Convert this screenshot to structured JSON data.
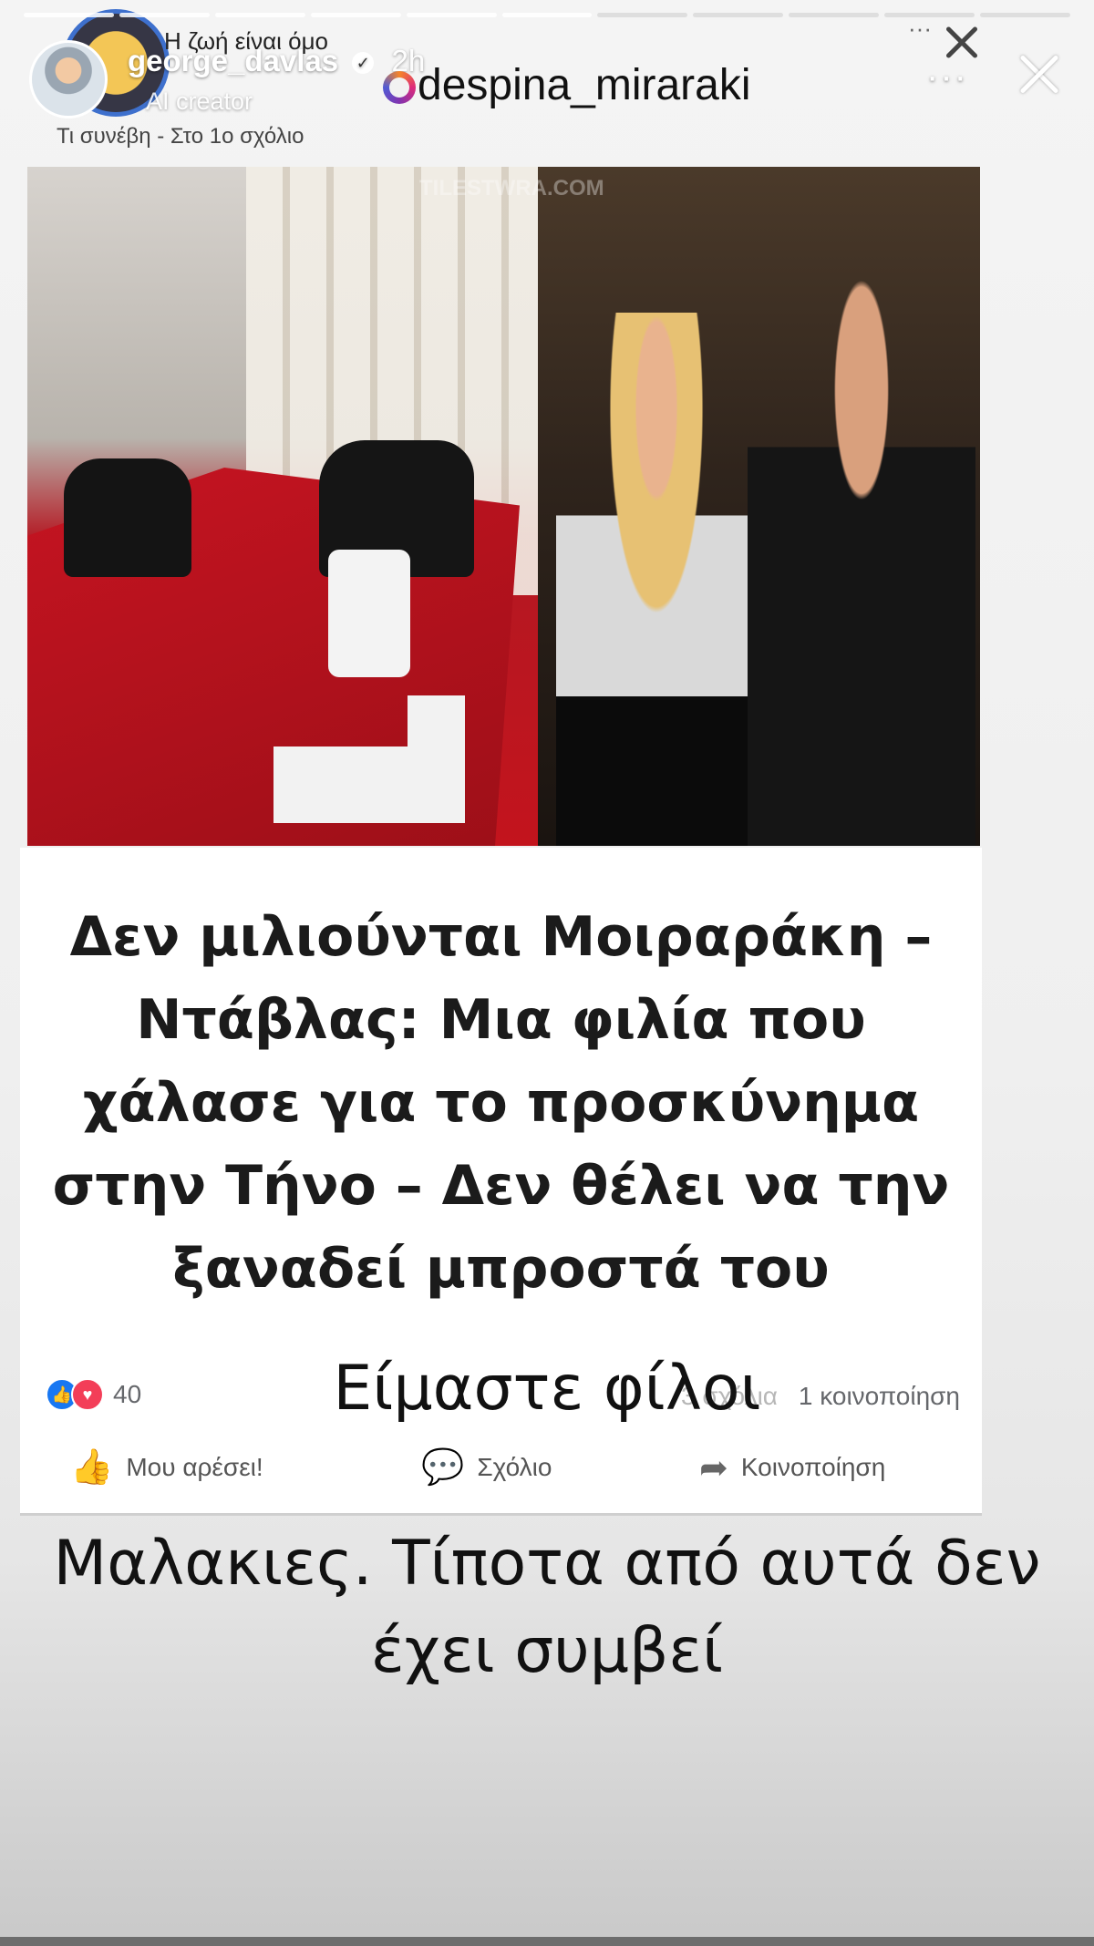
{
  "story": {
    "username": "george_davlas",
    "time": "2h",
    "subtitle": "AI creator",
    "more_label": "···"
  },
  "shared_post": {
    "page_name": "Η ζωή είναι όμο",
    "page_sub": "Τι συνέβη - Στο 1ο σχόλιο",
    "dots": "···"
  },
  "mention": {
    "handle": "despina_miraraki"
  },
  "photo": {
    "watermark": "TILESTWRA.COM"
  },
  "headline": {
    "text": "Δεν μιλιούνται Μοιραράκη – Ντάβλας: Μια φιλία που χάλασε για το προσκύνημα στην Τήνο – Δεν θέλει να την ξαναδεί μπροστά του"
  },
  "facebook": {
    "reaction_count": "40",
    "comment_count": "3 σχόλια",
    "share_count": "1 κοινοποίηση",
    "like_label": "Μου αρέσει!",
    "comment_label": "Σχόλιο",
    "share_label": "Κοινοποίηση"
  },
  "overlay": {
    "line1": "Είμαστε φίλοι",
    "line2": "Μαλακιες. Τίποτα από αυτά δεν έχει συμβεί"
  },
  "colors": {
    "fb_blue": "#1877f2",
    "love_red": "#f33e58",
    "carpet_red": "#c61421"
  }
}
